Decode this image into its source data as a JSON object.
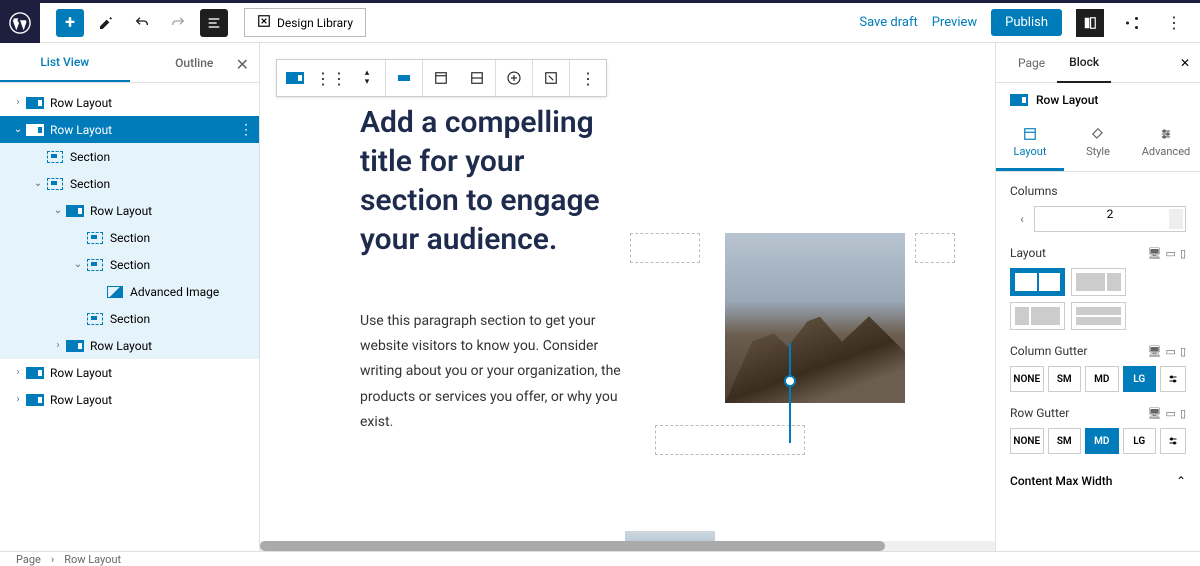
{
  "header": {
    "design_library": "Design Library",
    "save_draft": "Save draft",
    "preview": "Preview",
    "publish": "Publish"
  },
  "left_panel": {
    "tabs": {
      "list_view": "List View",
      "outline": "Outline"
    },
    "tree": [
      {
        "label": "Row Layout",
        "depth": 0,
        "kind": "row",
        "chev": "›"
      },
      {
        "label": "Row Layout",
        "depth": 0,
        "kind": "row",
        "chev": "⌄",
        "selected": true
      },
      {
        "label": "Section",
        "depth": 1,
        "kind": "section",
        "child": true
      },
      {
        "label": "Section",
        "depth": 1,
        "kind": "section",
        "chev": "⌄",
        "child": true
      },
      {
        "label": "Row Layout",
        "depth": 2,
        "kind": "row",
        "chev": "⌄",
        "child": true
      },
      {
        "label": "Section",
        "depth": 3,
        "kind": "section",
        "child": true
      },
      {
        "label": "Section",
        "depth": 3,
        "kind": "section",
        "chev": "⌄",
        "child": true
      },
      {
        "label": "Advanced Image",
        "depth": 4,
        "kind": "image",
        "child": true
      },
      {
        "label": "Section",
        "depth": 3,
        "kind": "section",
        "child": true
      },
      {
        "label": "Row Layout",
        "depth": 2,
        "kind": "row",
        "chev": "›",
        "child": true
      },
      {
        "label": "Row Layout",
        "depth": 0,
        "kind": "row",
        "chev": "›"
      },
      {
        "label": "Row Layout",
        "depth": 0,
        "kind": "row",
        "chev": "›"
      }
    ]
  },
  "canvas": {
    "heading": "Add a compelling title for your section to engage your audience.",
    "paragraph": "Use this paragraph section to get your website visitors to know you. Consider writing about you or your organization, the products or services you offer, or why you exist."
  },
  "right_panel": {
    "tabs": {
      "page": "Page",
      "block": "Block"
    },
    "block_name": "Row Layout",
    "subtabs": {
      "layout": "Layout",
      "style": "Style",
      "advanced": "Advanced"
    },
    "columns_label": "Columns",
    "columns_value": "2",
    "layout_label": "Layout",
    "col_gutter_label": "Column Gutter",
    "row_gutter_label": "Row Gutter",
    "gutter_opts": [
      "NONE",
      "SM",
      "MD",
      "LG"
    ],
    "col_gutter_sel": "LG",
    "row_gutter_sel": "MD",
    "content_max_width": "Content Max Width"
  },
  "breadcrumb": {
    "page": "Page",
    "block": "Row Layout"
  }
}
